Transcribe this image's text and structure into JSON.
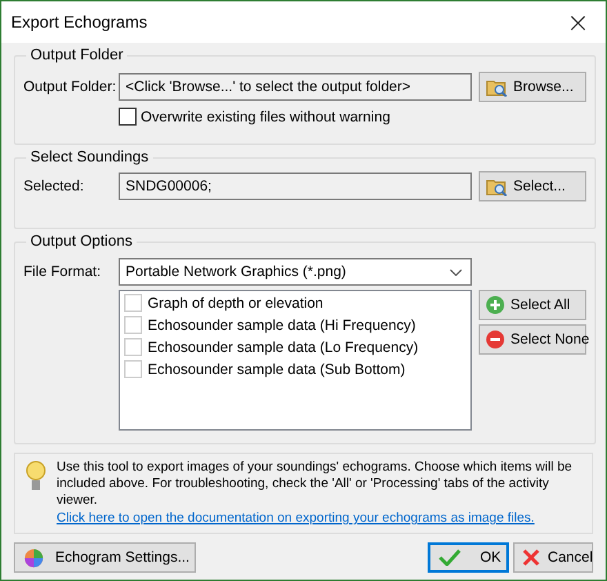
{
  "window": {
    "title": "Export Echograms",
    "close": "×"
  },
  "output_folder": {
    "title": "Output Folder",
    "label": "Output Folder:",
    "value": "<Click 'Browse...' to select the output folder>",
    "button": "Browse...",
    "overwrite": {
      "label": "Overwrite existing files without warning",
      "checked": false
    }
  },
  "select_soundings": {
    "title": "Select Soundings",
    "label": "Selected:",
    "value": "SNDG00006;",
    "button": "Select..."
  },
  "output_options": {
    "title": "Output Options",
    "label": "File Format:",
    "format": "Portable Network Graphics (*.png)",
    "items": [
      {
        "label": "Graph of depth or elevation",
        "checked": false
      },
      {
        "label": "Echosounder sample data (Hi Frequency)",
        "checked": false
      },
      {
        "label": "Echosounder sample data (Lo Frequency)",
        "checked": false
      },
      {
        "label": "Echosounder sample data (Sub Bottom)",
        "checked": false
      }
    ],
    "select_all": "Select All",
    "select_none": "Select None"
  },
  "info": {
    "text": "Use this tool to export images of your soundings' echograms. Choose which items will be included above. For troubleshooting, check the 'All' or 'Processing' tabs of the activity viewer.",
    "link": "Click here to open the documentation on exporting your echograms as image files."
  },
  "buttons": {
    "settings": "Echogram Settings...",
    "ok": "OK",
    "cancel": "Cancel"
  }
}
